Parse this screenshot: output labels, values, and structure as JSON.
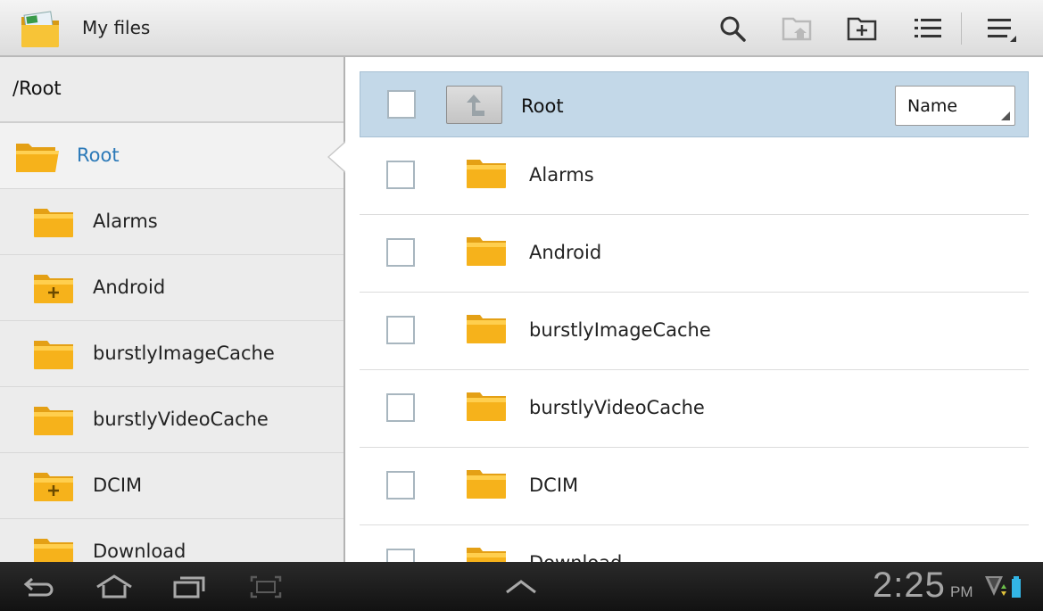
{
  "app": {
    "title": "My files",
    "icon": "my-files-folder-icon"
  },
  "toolbar": {
    "actions": [
      {
        "name": "search",
        "icon": "search-icon",
        "enabled": true
      },
      {
        "name": "go-home",
        "icon": "folder-home-icon",
        "enabled": false
      },
      {
        "name": "new-folder",
        "icon": "new-folder-icon",
        "enabled": true
      },
      {
        "name": "view-list",
        "icon": "list-view-icon",
        "enabled": true
      },
      {
        "name": "menu",
        "icon": "overflow-menu-icon",
        "enabled": true
      }
    ]
  },
  "sidebar": {
    "path": "/Root",
    "root_label": "Root",
    "items": [
      {
        "label": "Alarms",
        "expandable": false
      },
      {
        "label": "Android",
        "expandable": true
      },
      {
        "label": "burstlyImageCache",
        "expandable": false
      },
      {
        "label": "burstlyVideoCache",
        "expandable": false
      },
      {
        "label": "DCIM",
        "expandable": true
      },
      {
        "label": "Download",
        "expandable": false
      }
    ]
  },
  "main": {
    "current_folder": "Root",
    "sort_by": "Name",
    "files": [
      {
        "label": "Alarms",
        "type": "folder"
      },
      {
        "label": "Android",
        "type": "folder"
      },
      {
        "label": "burstlyImageCache",
        "type": "folder"
      },
      {
        "label": "burstlyVideoCache",
        "type": "folder"
      },
      {
        "label": "DCIM",
        "type": "folder"
      },
      {
        "label": "Download",
        "type": "folder"
      }
    ]
  },
  "system_bar": {
    "time": "2:25",
    "ampm": "PM",
    "nav_buttons": [
      "back-icon",
      "home-icon",
      "recent-apps-icon",
      "screenshot-icon"
    ],
    "center_button": "chevron-up-icon"
  },
  "colors": {
    "folder_yellow": "#f6b21b",
    "accent_blue": "#2b79b8",
    "selected_row": "#c3d8e8"
  }
}
